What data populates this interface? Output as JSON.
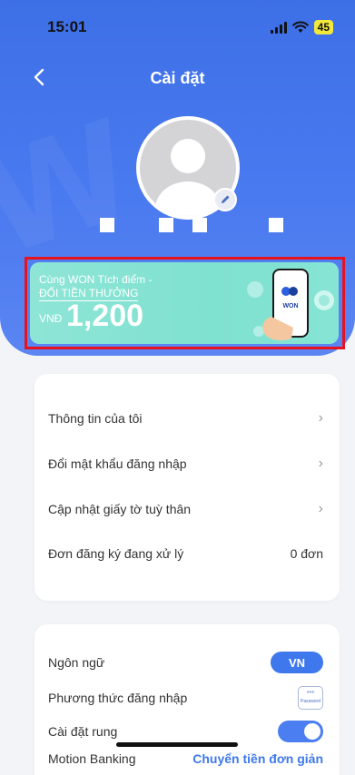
{
  "status_bar": {
    "time": "15:01",
    "battery": "45"
  },
  "header": {
    "title": "Cài đặt"
  },
  "promo": {
    "line1": "Cùng WON Tích điểm -",
    "line2": "ĐỔI TIỀN THƯỞNG",
    "currency": "VNĐ",
    "amount": "1,200",
    "phone_brand": "WON"
  },
  "account_menu": {
    "items": [
      {
        "label": "Thông tin của tôi"
      },
      {
        "label": "Đổi mật khẩu đăng nhập"
      },
      {
        "label": "Cập nhật giấy tờ tuỳ thân"
      },
      {
        "label": "Đơn đăng ký đang xử lý",
        "value": "0 đơn"
      }
    ]
  },
  "settings": {
    "language": {
      "label": "Ngôn ngữ",
      "value": "VN"
    },
    "login_method": {
      "label": "Phương thức đăng nhập",
      "icon_text": "***",
      "icon_caption": "Password"
    },
    "vibration": {
      "label": "Cài đặt rung",
      "enabled": true
    },
    "motion_banking": {
      "label": "Motion Banking",
      "value": "Chuyển tiền đơn giản"
    }
  },
  "colors": {
    "header_blue": "#4a7af0",
    "accent_blue": "#3f78ec",
    "promo_teal": "#8ee5d6",
    "highlight_red": "#e8121e"
  },
  "icons": [
    "back-chevron-icon",
    "signal-icon",
    "wifi-icon",
    "battery-icon",
    "avatar-placeholder",
    "edit-pencil-icon",
    "chevron-right-icon",
    "password-icon",
    "coin-icon"
  ]
}
